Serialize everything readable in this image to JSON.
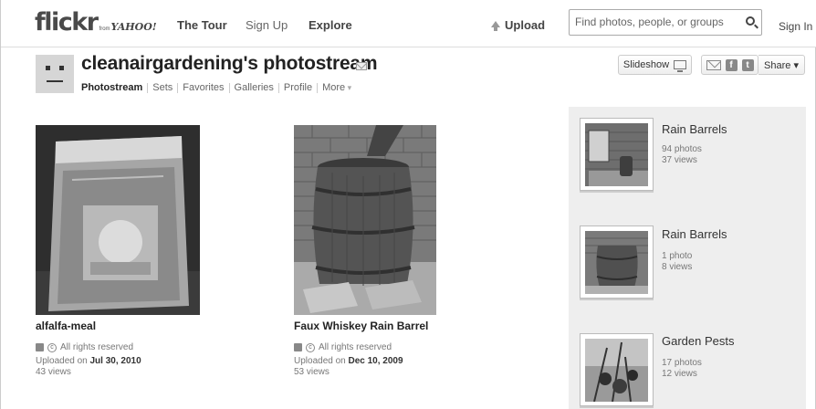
{
  "topnav": {
    "logo_word": "flickr",
    "logo_from": "from",
    "logo_yahoo": "YAHOO!",
    "tour": "The Tour",
    "signup": "Sign Up",
    "explore": "Explore",
    "upload": "Upload",
    "search_placeholder": "Find photos, people, or groups",
    "signin": "Sign In"
  },
  "profile": {
    "title": "cleanairgardening's photostream",
    "subnav": [
      "Photostream",
      "Sets",
      "Favorites",
      "Galleries",
      "Profile",
      "More"
    ],
    "slideshow": "Slideshow",
    "share": "Share ▾"
  },
  "photos": [
    {
      "title": "alfalfa-meal",
      "rights": "All rights reserved",
      "uploaded_label": "Uploaded on",
      "uploaded_date": "Jul 30, 2010",
      "views": "43 views"
    },
    {
      "title": "Faux Whiskey Rain Barrel",
      "rights": "All rights reserved",
      "uploaded_label": "Uploaded on",
      "uploaded_date": "Dec 10, 2009",
      "views": "53 views"
    }
  ],
  "sets": [
    {
      "title": "Rain Barrels",
      "photos": "94 photos",
      "views": "37 views"
    },
    {
      "title": "Rain Barrels",
      "photos": "1 photo",
      "views": "8 views"
    },
    {
      "title": "Garden Pests",
      "photos": "17 photos",
      "views": "12 views"
    }
  ],
  "icons": {
    "upload": "upload-arrow-icon",
    "search": "search-icon",
    "mail": "mail-icon",
    "slideshow": "screen-icon",
    "email_share": "envelope-icon",
    "facebook": "facebook-icon",
    "twitter": "twitter-icon",
    "license": "license-icon",
    "copyright": "copyright-icon"
  }
}
